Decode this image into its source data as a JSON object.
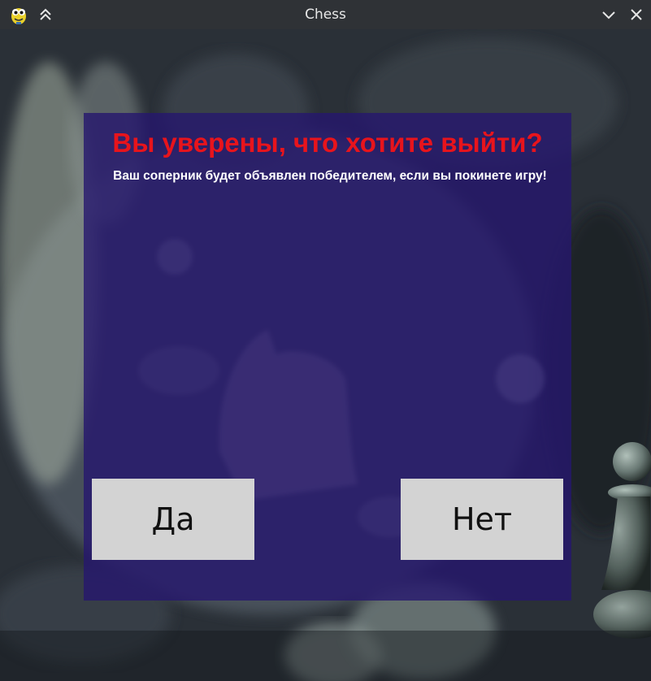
{
  "window": {
    "title": "Chess",
    "app_icon": "pygame-snake-icon",
    "controls": {
      "shade": "chevrons-up-icon",
      "minimize": "chevron-down-icon",
      "close": "close-icon"
    },
    "titlebar_color": "#2f3236"
  },
  "background": {
    "description_icon": "chess-pieces-photo"
  },
  "dialog": {
    "title": "Вы уверены, что хотите выйти?",
    "message": "Ваш соперник будет объявлен победителем, если вы покинете игру!",
    "title_color": "#e8141c",
    "message_color": "#ffffff",
    "panel_color": "#26166e",
    "buttons": {
      "yes_label": "Да",
      "no_label": "Нет",
      "button_color": "#d3d3d3"
    }
  }
}
